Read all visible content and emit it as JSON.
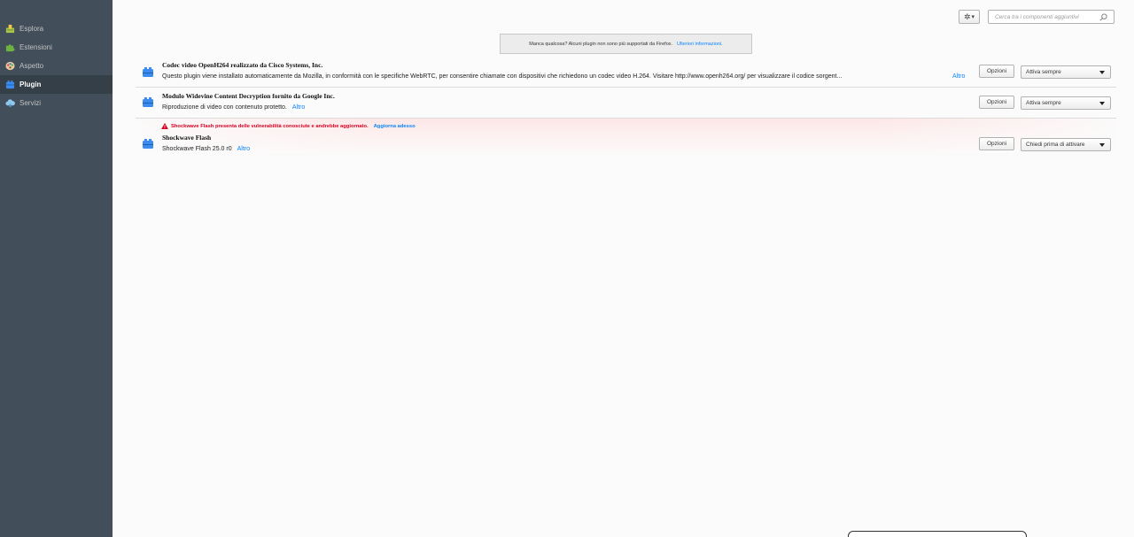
{
  "sidebar": {
    "items": [
      {
        "label": "Esplora",
        "icon": "explore-icon",
        "active": false
      },
      {
        "label": "Estensioni",
        "icon": "puzzle-icon",
        "active": false
      },
      {
        "label": "Aspetto",
        "icon": "palette-icon",
        "active": false
      },
      {
        "label": "Plugin",
        "icon": "plugin-icon",
        "active": true
      },
      {
        "label": "Servizi",
        "icon": "cloud-icon",
        "active": false
      }
    ]
  },
  "toolbar": {
    "gear_label": "▾",
    "search_placeholder": "Cerca tra i componenti aggiuntivi"
  },
  "notice": {
    "text": "Manca qualcosa? Alcuni plugin non sono più supportati da Firefox.",
    "link": "Ulteriori informazioni."
  },
  "plugins": [
    {
      "name": "Codec video OpenH264 realizzato da Cisco Systems, Inc.",
      "description": "Questo plugin viene installato automaticamente da Mozilla, in conformità con le specifiche WebRTC, per consentire chiamate con dispositivi che richiedono un codec video H.264. Visitare http://www.openh264.org/ per visualizzare il codice sorgent...",
      "more": "Altro",
      "options": "Opzioni",
      "state": "Attiva sempre"
    },
    {
      "name": "Modulo Widevine Content Decryption fornito da Google Inc.",
      "description": "Riproduzione di video con contenuto protetto.",
      "more": "Altro",
      "options": "Opzioni",
      "state": "Attiva sempre"
    },
    {
      "warning": "Shockwave Flash presenta delle vulnerabilità conosciute e andrebbe aggiornato.",
      "warning_action": "Aggiorna adesso",
      "name": "Shockwave Flash",
      "description": "Shockwave Flash 25.0 r0",
      "more": "Altro",
      "options": "Opzioni",
      "state": "Chiedi prima di attivare"
    }
  ],
  "colors": {
    "sidebar_bg": "#424f5a",
    "sidebar_active": "#343f48",
    "link": "#0a84ff",
    "warning": "#d70022"
  }
}
